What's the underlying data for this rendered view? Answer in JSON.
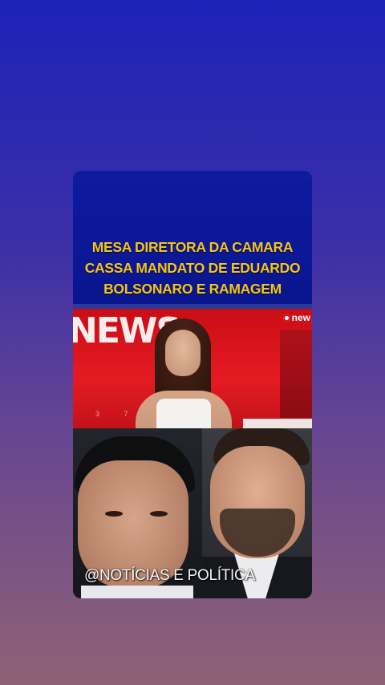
{
  "post": {
    "headline_lines": [
      "MESA DIRETORA DA CAMARA",
      "CASSA MANDATO DE EDUARDO",
      "BOLSONARO E RAMAGEM"
    ],
    "news_word": "NEWS",
    "channel_logo": "new",
    "desk_numbers": "3 7 8",
    "watermark": "@NOTÍCIAS E POLÍTICA"
  },
  "colors": {
    "headline_text": "#f5c518",
    "headline_bg": "#0e1aa0",
    "news_red": "#e51b22",
    "background_top": "#1d22b8",
    "background_bottom": "#8e6274"
  },
  "icons": {
    "channel_logo_icon": "globo-circle-icon"
  }
}
